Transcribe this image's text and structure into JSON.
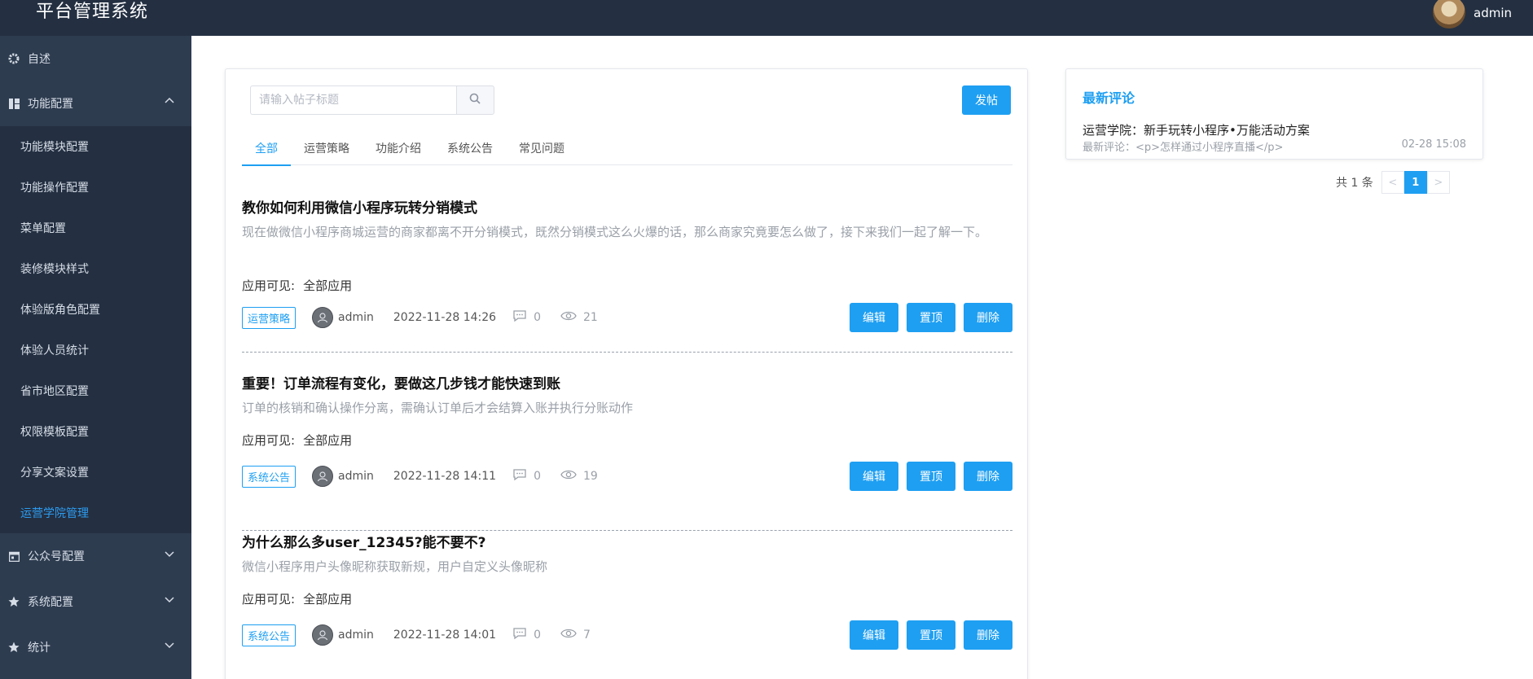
{
  "header": {
    "brand": "平台管理系统",
    "username": "admin"
  },
  "sidebar": {
    "top_item": "自述",
    "groups": [
      {
        "label": "功能配置",
        "icon": "grid-icon",
        "expanded": true,
        "items": [
          "功能模块配置",
          "功能操作配置",
          "菜单配置",
          "装修模块样式",
          "体验版角色配置",
          "体验人员统计",
          "省市地区配置",
          "权限模板配置",
          "分享文案设置",
          "运营学院管理"
        ],
        "active_index": 9
      },
      {
        "label": "公众号配置",
        "icon": "calendar-icon",
        "expanded": false
      },
      {
        "label": "系统配置",
        "icon": "star-icon",
        "expanded": false
      },
      {
        "label": "统计",
        "icon": "star-icon",
        "expanded": false
      }
    ]
  },
  "main": {
    "search_placeholder": "请输入帖子标题",
    "post_button": "发帖",
    "tabs": [
      "全部",
      "运营策略",
      "功能介绍",
      "系统公告",
      "常见问题"
    ],
    "active_tab": 0,
    "visibility_label": "应用可见:",
    "actions": {
      "edit": "编辑",
      "pin": "置顶",
      "delete": "删除"
    },
    "posts": [
      {
        "title": "教你如何利用微信小程序玩转分销模式",
        "desc": "现在做微信小程序商城运营的商家都离不开分销模式，既然分销模式这么火爆的话，那么商家究竟要怎么做了，接下来我们一起了解一下。",
        "visible": "全部应用",
        "tag": "运营策略",
        "author": "admin",
        "date": "2022-11-28 14:26",
        "comments": "0",
        "views": "21"
      },
      {
        "title": "重要！订单流程有变化，要做这几步钱才能快速到账",
        "desc": "订单的核销和确认操作分离，需确认订单后才会结算入账并执行分账动作",
        "visible": "全部应用",
        "tag": "系统公告",
        "author": "admin",
        "date": "2022-11-28 14:11",
        "comments": "0",
        "views": "19"
      },
      {
        "title": "为什么那么多user_12345?能不要不?",
        "desc": "微信小程序用户头像昵称获取新规，用户自定义头像昵称",
        "visible": "全部应用",
        "tag": "系统公告",
        "author": "admin",
        "date": "2022-11-28 14:01",
        "comments": "0",
        "views": "7"
      }
    ]
  },
  "comments_panel": {
    "title": "最新评论",
    "item_title": "运营学院：新手玩转小程序•万能活动方案",
    "item_sub": "最新评论：<p>怎样通过小程序直播</p>",
    "item_time": "02-28 15:08"
  },
  "pagination": {
    "total": "共 1 条",
    "current": "1",
    "prev": "<",
    "next": ">"
  },
  "colors": {
    "topbar": "#243042",
    "sidebar": "#2e3c50",
    "submenu": "#243042",
    "accent": "#1e9ff2"
  }
}
